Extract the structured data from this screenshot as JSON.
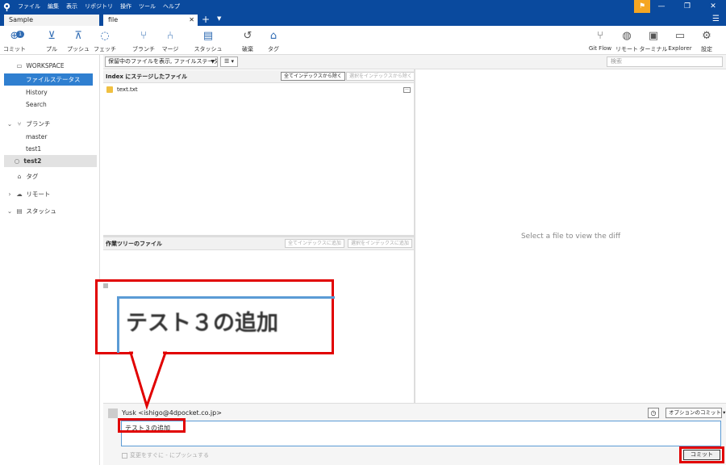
{
  "menu": [
    "ファイル",
    "編集",
    "表示",
    "リポジトリ",
    "操作",
    "ツール",
    "ヘルプ"
  ],
  "tabs": [
    {
      "label": "Sample"
    },
    {
      "label": "file"
    }
  ],
  "toolbar": [
    {
      "label": "コミット",
      "icon": "commit-icon",
      "badge": "1"
    },
    {
      "label": "プル",
      "icon": "pull-icon"
    },
    {
      "label": "プッシュ",
      "icon": "push-icon"
    },
    {
      "label": "フェッチ",
      "icon": "fetch-icon"
    },
    {
      "label": "ブランチ",
      "icon": "branch-icon"
    },
    {
      "label": "マージ",
      "icon": "merge-icon"
    },
    {
      "label": "スタッシュ",
      "icon": "stash-icon"
    },
    {
      "label": "破棄",
      "icon": "discard-icon"
    },
    {
      "label": "タグ",
      "icon": "tag-icon"
    }
  ],
  "toolbar_right": [
    {
      "label": "Git Flow",
      "icon": "gitflow-icon"
    },
    {
      "label": "リモート",
      "icon": "remote-icon"
    },
    {
      "label": "ターミナル",
      "icon": "terminal-icon"
    },
    {
      "label": "Explorer",
      "icon": "explorer-icon"
    },
    {
      "label": "設定",
      "icon": "settings-icon"
    }
  ],
  "sidebar": {
    "workspace": "WORKSPACE",
    "workspace_items": [
      "ファイルステータス",
      "History",
      "Search"
    ],
    "branches_label": "ブランチ",
    "branches": [
      "master",
      "test1",
      "test2"
    ],
    "tags_label": "タグ",
    "remotes_label": "リモート",
    "stashes_label": "スタッシュ"
  },
  "filter": {
    "select_value": "保留中のファイルを表示, ファイルステータス順",
    "search_placeholder": "検索"
  },
  "staged": {
    "title": "Index にステージしたファイル",
    "unstage_all": "全てインデックスから除く",
    "unstage_selected": "選択をインデックスから除く",
    "files": [
      "text.txt"
    ]
  },
  "unstaged": {
    "title": "作業ツリーのファイル",
    "stage_all": "全てインデックスに追加",
    "stage_selected": "選択をインデックスに追加"
  },
  "diff": {
    "placeholder": "Select a file to view the diff"
  },
  "commit": {
    "author": "Yusk <ishigo@4dpocket.co.jp>",
    "options": "オプションのコミット",
    "message": "テスト３の追加",
    "push_now": "変更をすぐに - にプッシュする",
    "button": "コミット"
  },
  "zoom": {
    "text": "テスト３の追加"
  },
  "colors": {
    "titlebar": "#0a4a9e",
    "accent": "#2f7fd0",
    "annotation": "#e10000",
    "flag": "#f5a623"
  }
}
